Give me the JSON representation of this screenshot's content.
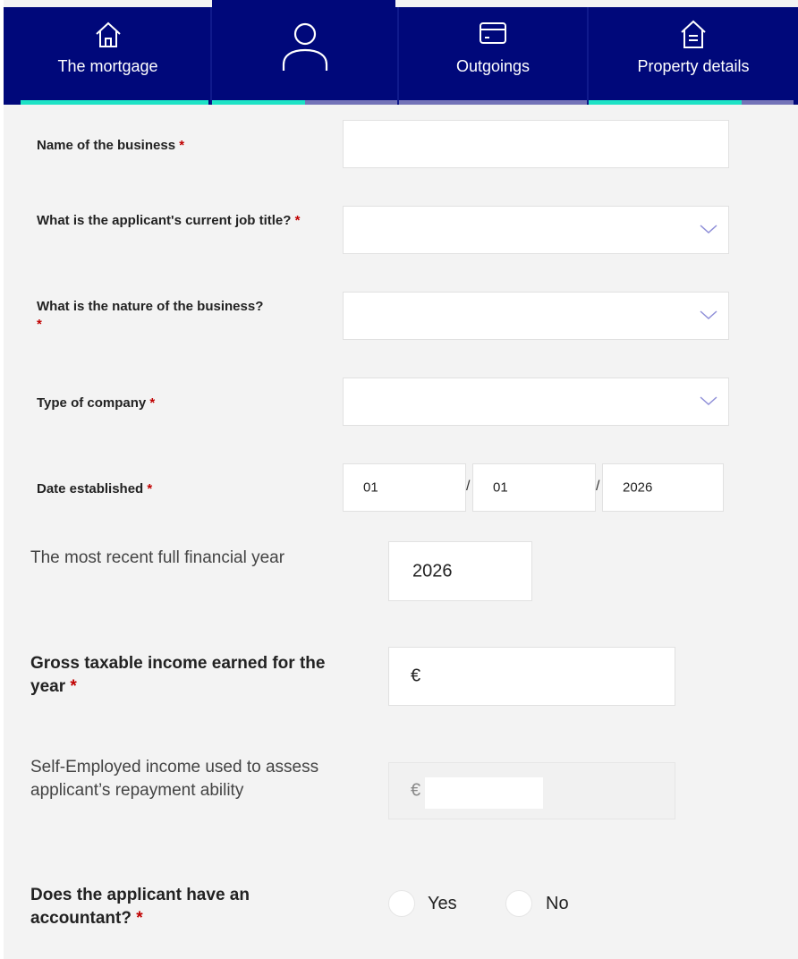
{
  "nav": {
    "tabs": [
      {
        "label": "The mortgage",
        "icon": "house-icon"
      },
      {
        "label": "",
        "icon": "person-icon"
      },
      {
        "label": "Outgoings",
        "icon": "card-icon"
      },
      {
        "label": "Property details",
        "icon": "home-document-icon"
      }
    ],
    "colors": {
      "background": "#00087a",
      "complete": "#1de2c5",
      "pending": "#7373b8"
    }
  },
  "form": {
    "required_marker": "*",
    "business_name": {
      "label": "Name of the business",
      "value": ""
    },
    "job_title": {
      "label": "What is the applicant's current job title?",
      "value": ""
    },
    "business_nature": {
      "label": "What is the nature of the business?",
      "value": ""
    },
    "company_type": {
      "label": "Type of company",
      "value": ""
    },
    "date_established": {
      "label": "Date established",
      "day": "01",
      "month": "01",
      "year": "2026",
      "separator": "/"
    },
    "financial_year": {
      "label": "The most recent full financial year",
      "value": "2026"
    },
    "gross_income": {
      "label": "Gross taxable income earned for the year",
      "currency": "€",
      "value": ""
    },
    "self_employed_income": {
      "label": "Self-Employed income used to assess applicant’s repayment ability",
      "currency": "€",
      "value": ""
    },
    "accountant": {
      "label": "Does the applicant have an accountant?",
      "options": [
        "Yes",
        "No"
      ],
      "selected": ""
    }
  }
}
